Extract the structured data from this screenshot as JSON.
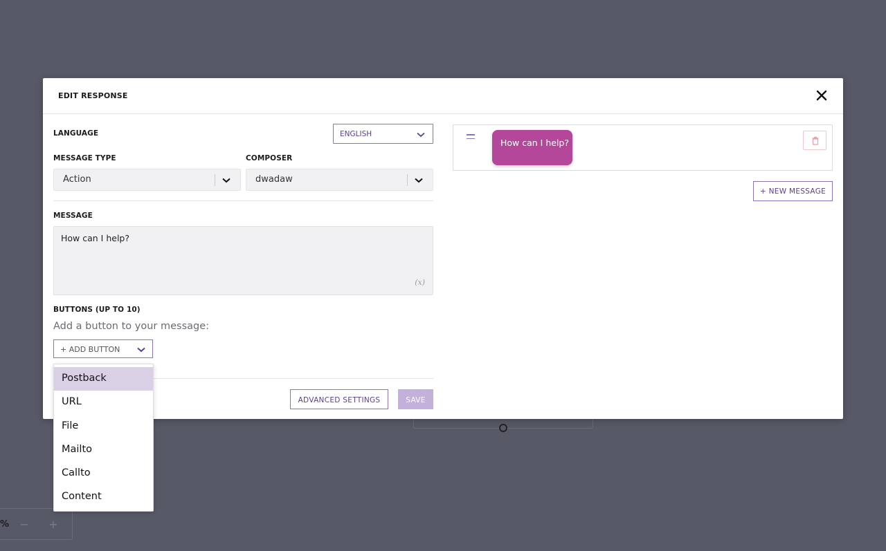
{
  "modal": {
    "title": "EDIT RESPONSE"
  },
  "form": {
    "language_label": "LANGUAGE",
    "language_value": "ENGLISH",
    "message_type_label": "MESSAGE TYPE",
    "message_type_value": "Action",
    "composer_label": "COMPOSER",
    "composer_value": "dwadaw",
    "message_label": "MESSAGE",
    "message_value": "How can I help?",
    "variable_icon": "(x)",
    "buttons_label": "BUTTONS (UP TO 10)",
    "buttons_hint": "Add a button to your message:",
    "add_button_label": "+ ADD BUTTON",
    "advanced_settings_label": "ADVANCED SETTINGS",
    "save_label": "SAVE"
  },
  "preview": {
    "bubble_text": "How can I help?",
    "new_message_label": "+ NEW MESSAGE"
  },
  "dropdown": {
    "items": [
      "Postback",
      "URL",
      "File",
      "Mailto",
      "Callto",
      "Content"
    ],
    "selected": "Postback"
  },
  "canvas": {
    "zoom_suffix": "%",
    "zoom_out": "−",
    "zoom_in": "+"
  },
  "colors": {
    "accent": "#5a3f92",
    "bubble": "#b5479a",
    "backdrop": "#575966"
  }
}
